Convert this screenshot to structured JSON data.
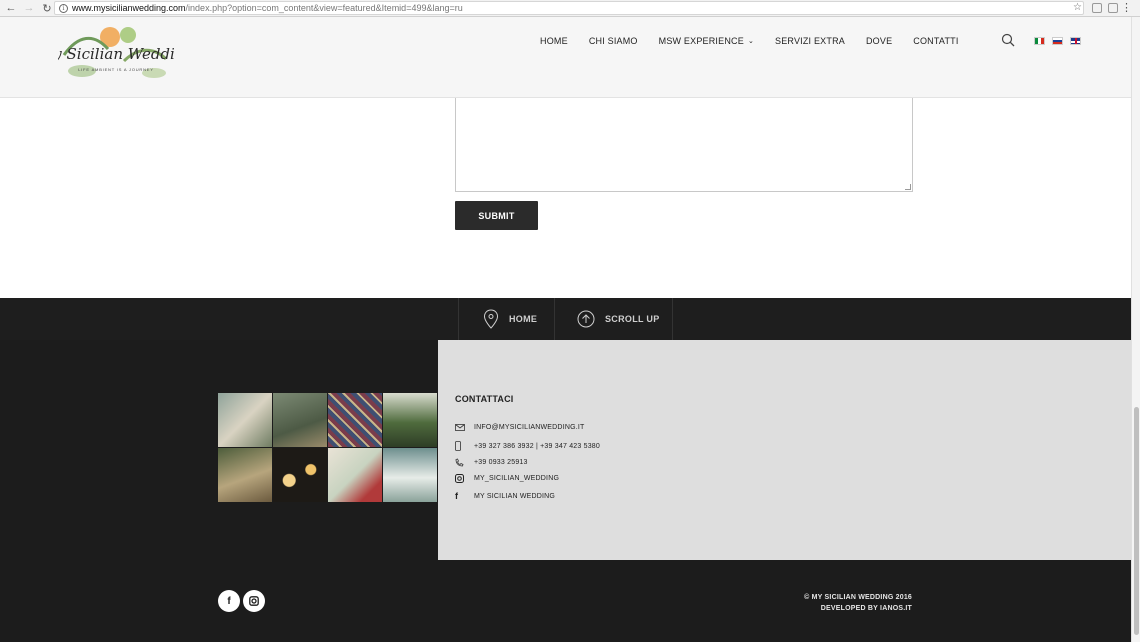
{
  "browser": {
    "url_host": "www.mysicilianwedding.com",
    "url_path": "/index.php?option=com_content&view=featured&Itemid=499&lang=ru"
  },
  "header": {
    "logo_title": "My Sicilian Wedding",
    "logo_tagline": "LIFE AMBIENT IS A JOURNEY",
    "nav": [
      {
        "label": "HOME"
      },
      {
        "label": "CHI SIAMO"
      },
      {
        "label": "MSW EXPERIENCE",
        "has_dropdown": true
      },
      {
        "label": "SERVIZI EXTRA"
      },
      {
        "label": "DOVE"
      },
      {
        "label": "CONTATTI"
      }
    ],
    "languages": [
      "it",
      "ru",
      "en"
    ]
  },
  "form": {
    "message_value": "",
    "submit_label": "SUBMIT"
  },
  "footer_bar": {
    "home_label": "HOME",
    "scroll_up_label": "SCROLL UP"
  },
  "contacts": {
    "title": "CONTATTACI",
    "email": "INFO@MYSICILIANWEDDING.IT",
    "mobile": "+39 327 386 3932 | +39 347 423 5380",
    "phone": "+39 0933 25913",
    "instagram": "MY_SICILIAN_WEDDING",
    "facebook": "MY SICILIAN WEDDING"
  },
  "footer": {
    "copyright": "© MY SICILIAN WEDDING 2016",
    "developer": "DEVELOPED BY IANOS.IT",
    "social": [
      "facebook-icon",
      "instagram-icon"
    ]
  },
  "colors": {
    "footer_dark": "#1c1c1c",
    "contact_panel": "#dedede",
    "button_dark": "#2b2b2b"
  }
}
